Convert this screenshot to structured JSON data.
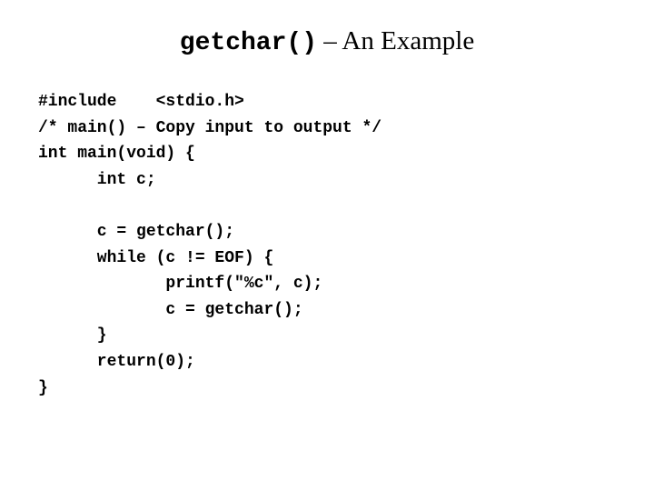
{
  "slide": {
    "background_color": "#ffffff",
    "text_color": "#000000"
  },
  "title": {
    "code_part": "getchar()",
    "text_part": " – An Example",
    "full": "getchar() – An Example"
  },
  "code": {
    "language": "c",
    "lines": [
      "#include    <stdio.h>",
      "/* main() – Copy input to output */",
      "int main(void) {",
      "      int c;",
      "",
      "      c = getchar();",
      "      while (c != EOF) {",
      "             printf(\"%c\", c);",
      "             c = getchar();",
      "      }",
      "      return(0);",
      "}"
    ]
  }
}
